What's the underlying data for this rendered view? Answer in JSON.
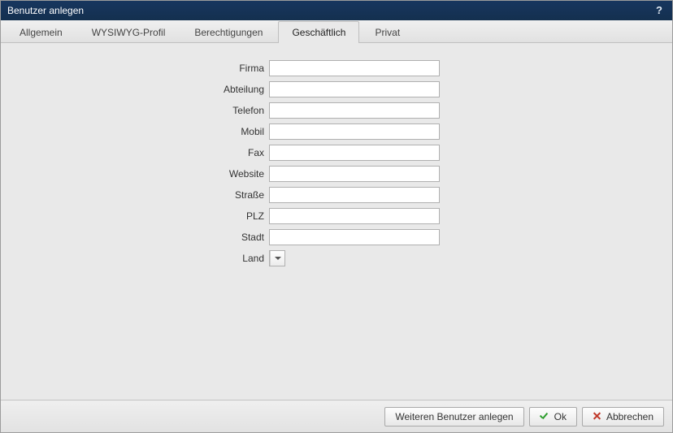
{
  "window": {
    "title": "Benutzer anlegen"
  },
  "tabs": [
    {
      "label": "Allgemein",
      "active": false
    },
    {
      "label": "WYSIWYG-Profil",
      "active": false
    },
    {
      "label": "Berechtigungen",
      "active": false
    },
    {
      "label": "Geschäftlich",
      "active": true
    },
    {
      "label": "Privat",
      "active": false
    }
  ],
  "form": {
    "fields": [
      {
        "label": "Firma",
        "value": "",
        "type": "text"
      },
      {
        "label": "Abteilung",
        "value": "",
        "type": "text"
      },
      {
        "label": "Telefon",
        "value": "",
        "type": "text"
      },
      {
        "label": "Mobil",
        "value": "",
        "type": "text"
      },
      {
        "label": "Fax",
        "value": "",
        "type": "text"
      },
      {
        "label": "Website",
        "value": "",
        "type": "text"
      },
      {
        "label": "Straße",
        "value": "",
        "type": "text"
      },
      {
        "label": "PLZ",
        "value": "",
        "type": "text"
      },
      {
        "label": "Stadt",
        "value": "",
        "type": "text"
      },
      {
        "label": "Land",
        "value": "",
        "type": "dropdown"
      }
    ]
  },
  "footer": {
    "create_another": "Weiteren Benutzer anlegen",
    "ok": "Ok",
    "cancel": "Abbrechen"
  }
}
